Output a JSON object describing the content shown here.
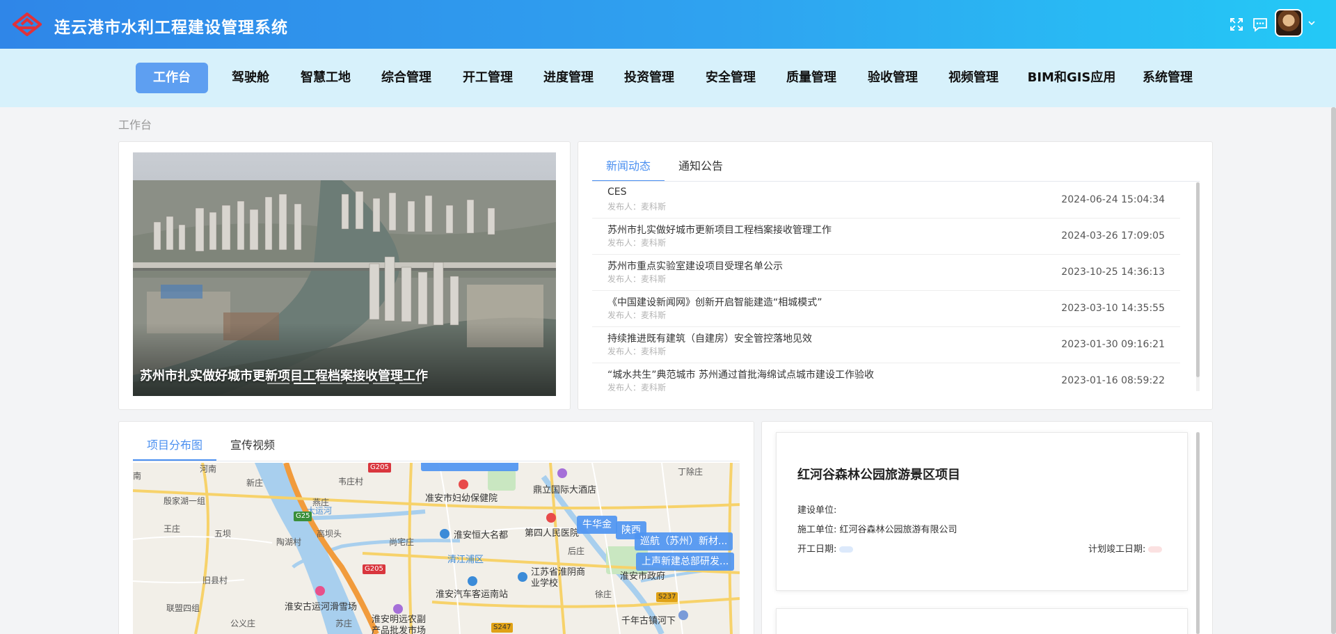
{
  "header": {
    "app_title": "连云港市水利工程建设管理系统",
    "icons": [
      "fullscreen-icon",
      "message-icon",
      "avatar",
      "chevron-down-icon"
    ],
    "colors": {
      "header_start": "#2f86e8",
      "header_end": "#24c9f6",
      "logo": "#e0313a"
    }
  },
  "nav": {
    "items": [
      "工作台",
      "驾驶舱",
      "智慧工地",
      "综合管理",
      "开工管理",
      "进度管理",
      "投资管理",
      "安全管理",
      "质量管理",
      "验收管理",
      "视频管理",
      "BIM和GIS应用",
      "系统管理"
    ],
    "active": "工作台",
    "colors": {
      "bar": "#d7f1fb",
      "active_bg": "#5e9ff1"
    }
  },
  "breadcrumb": "工作台",
  "carousel": {
    "caption": "苏州市扎实做好城市更新项目工程档案接收管理工作",
    "slide_count": 6,
    "active_index": 1
  },
  "news": {
    "tabs": [
      "新闻动态",
      "通知公告"
    ],
    "active_tab": "新闻动态",
    "items": [
      {
        "title": "CES",
        "author": "发布人：麦科斯",
        "date": "2024-06-24 15:04:34"
      },
      {
        "title": "苏州市扎实做好城市更新项目工程档案接收管理工作",
        "author": "发布人：麦科斯",
        "date": "2024-03-26 17:09:05"
      },
      {
        "title": "苏州市重点实验室建设项目受理名单公示",
        "author": "发布人：麦科斯",
        "date": "2023-10-25 14:36:13"
      },
      {
        "title": "《中国建设新闻网》创新开启智能建造“相城模式”",
        "author": "发布人：麦科斯",
        "date": "2023-03-10 14:35:55"
      },
      {
        "title": "持续推进既有建筑（自建房）安全管控落地见效",
        "author": "发布人：麦科斯",
        "date": "2023-01-30 09:16:21"
      },
      {
        "title": "“城水共生”典范城市 苏州通过首批海绵试点城市建设工作验收",
        "author": "发布人：麦科斯",
        "date": "2023-01-16 08:59:22"
      }
    ]
  },
  "map_panel": {
    "tabs": [
      "项目分布图",
      "宣传视频"
    ],
    "active_tab": "项目分布图",
    "places": [
      "河南",
      "新庄",
      "韦庄村",
      "丁除庄",
      "南",
      "殷家湖一组",
      "燕庄",
      "王庄",
      "五坝",
      "高坝头",
      "尚宅庄",
      "陶湖村",
      "旧县村",
      "联盟四组",
      "公义庄",
      "苏庄",
      "准安市妇幼保健院",
      "鼎立国际大酒店",
      "第四人民医院",
      "淮安恒大名都",
      "后庄",
      "清江浦区",
      "江苏省淮阴商业学校",
      "淮安市政府",
      "淮安汽车客运南站",
      "徐庄",
      "淮安古运河滑雪场",
      "淮安明远农副产品批发市场",
      "千年古镇河下",
      "大运河"
    ],
    "roads": [
      "G205",
      "G25",
      "G205",
      "S237",
      "S247"
    ],
    "markers": [
      "牛华金",
      "陕西",
      "巡航（苏州）新材...",
      "上声新建总部研发..."
    ]
  },
  "project": {
    "name": "红河谷森林公园旅游景区项目",
    "build_unit_label": "建设单位:",
    "build_unit": "",
    "construct_unit_label": "施工单位:",
    "construct_unit": "红河谷森林公园旅游有限公司",
    "start_label": "开工日期:",
    "end_label": "计划竣工日期:",
    "colors": {
      "start_pill": "#dce9fb",
      "end_pill": "#fbe1e1"
    }
  }
}
